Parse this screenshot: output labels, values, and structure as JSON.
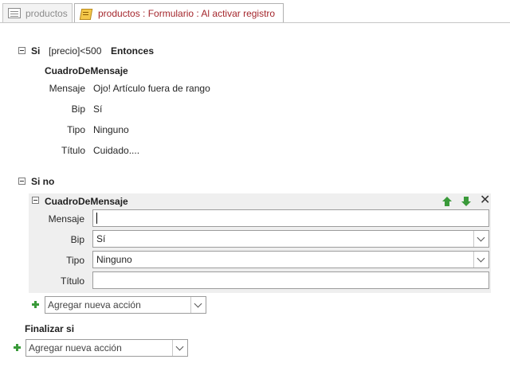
{
  "tabs": [
    {
      "label": "productos",
      "icon": "form-icon",
      "active": false
    },
    {
      "label": "productos : Formulario : Al activar registro",
      "icon": "macro-icon",
      "active": true
    }
  ],
  "if_block": {
    "keyword": "Si",
    "condition": "[precio]<500",
    "then": "Entonces",
    "action": {
      "name": "CuadroDeMensaje",
      "args": [
        {
          "label": "Mensaje",
          "value": "Ojo! Artículo fuera de rango"
        },
        {
          "label": "Bip",
          "value": "Sí"
        },
        {
          "label": "Tipo",
          "value": "Ninguno"
        },
        {
          "label": "Título",
          "value": "Cuidado...."
        }
      ]
    }
  },
  "else_block": {
    "keyword": "Si no",
    "action": {
      "name": "CuadroDeMensaje",
      "fields": [
        {
          "label": "Mensaje",
          "value": "",
          "type": "text"
        },
        {
          "label": "Bip",
          "value": "Sí",
          "type": "select"
        },
        {
          "label": "Tipo",
          "value": "Ninguno",
          "type": "select"
        },
        {
          "label": "Título",
          "value": "",
          "type": "text"
        }
      ]
    },
    "add_action": "Agregar nueva acción"
  },
  "end_if": "Finalizar si",
  "add_action_bottom": "Agregar nueva acción",
  "colors": {
    "active_tab_text": "#a4262c",
    "panel_bg": "#efefef",
    "arrow_green": "#3a9a3a"
  }
}
